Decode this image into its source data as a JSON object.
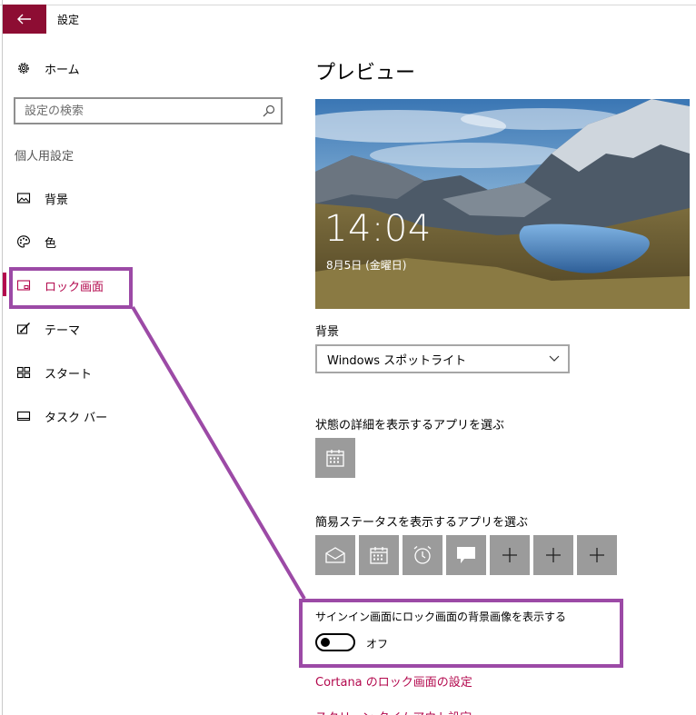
{
  "window": {
    "title": "設定"
  },
  "sidebar": {
    "home_label": "ホーム",
    "search_placeholder": "設定の検索",
    "section_title": "個人用設定",
    "items": [
      {
        "label": "背景",
        "icon": "picture-icon"
      },
      {
        "label": "色",
        "icon": "palette-icon"
      },
      {
        "label": "ロック画面",
        "icon": "lock-screen-icon",
        "active": true
      },
      {
        "label": "テーマ",
        "icon": "theme-icon"
      },
      {
        "label": "スタート",
        "icon": "start-icon"
      },
      {
        "label": "タスク バー",
        "icon": "taskbar-icon"
      }
    ]
  },
  "main": {
    "preview_heading": "プレビュー",
    "preview_time": "14:04",
    "preview_date": "8月5日 (金曜日)",
    "background_label": "背景",
    "background_value": "Windows スポットライト",
    "detail_status_label": "状態の詳細を表示するアプリを選ぶ",
    "quick_status_label": "簡易ステータスを表示するアプリを選ぶ",
    "quick_status_apps": [
      "mail-icon",
      "calendar-icon",
      "alarm-icon",
      "message-icon",
      "plus-icon",
      "plus-icon",
      "plus-icon"
    ],
    "signin_label": "サインイン画面にロック画面の背景画像を表示する",
    "signin_toggle_state": "オフ",
    "cortana_link": "Cortana のロック画面の設定",
    "timeout_link": "スクリーン タイムアウト設定"
  },
  "colors": {
    "accent": "#b3084d",
    "back_button": "#8d0d33",
    "tile": "#9b9b9b",
    "annotation": "#9c4aa6"
  }
}
